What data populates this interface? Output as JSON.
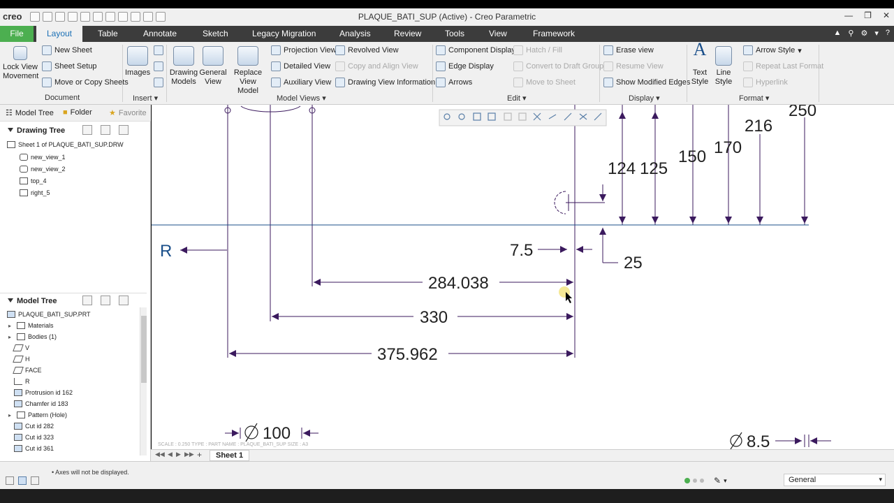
{
  "app": {
    "logo": "creo",
    "title": "PLAQUE_BATI_SUP (Active) - Creo Parametric"
  },
  "tabs": [
    "File",
    "Layout",
    "Table",
    "Annotate",
    "Sketch",
    "Legacy Migration",
    "Analysis",
    "Review",
    "Tools",
    "View",
    "Framework"
  ],
  "ribbon": {
    "document": {
      "group": "Document",
      "lock_view": "Lock View Movement",
      "new_sheet": "New Sheet",
      "sheet_setup": "Sheet Setup",
      "move_copy": "Move or Copy Sheets"
    },
    "insert": {
      "group": "Insert",
      "images": "Images"
    },
    "model_views": {
      "group": "Model Views",
      "drawing_models": "Drawing Models",
      "general_view": "General View",
      "replace_view_model": "Replace View Model",
      "projection_view": "Projection View",
      "detailed_view": "Detailed View",
      "auxiliary_view": "Auxiliary View",
      "revolved_view": "Revolved View",
      "copy_align_view": "Copy and Align View",
      "drawing_view_info": "Drawing View Information"
    },
    "edit": {
      "group": "Edit",
      "component_display": "Component Display",
      "edge_display": "Edge Display",
      "arrows": "Arrows",
      "hatch_fill": "Hatch / Fill",
      "convert_draft": "Convert to Draft Group",
      "move_to_sheet": "Move to Sheet"
    },
    "display": {
      "group": "Display",
      "erase_view": "Erase view",
      "resume_view": "Resume View",
      "show_modified_edges": "Show Modified Edges"
    },
    "format": {
      "group": "Format",
      "text_style": "Text Style",
      "line_style": "Line Style",
      "arrow_style": "Arrow Style",
      "repeat_last_format": "Repeat Last Format",
      "hyperlink": "Hyperlink"
    }
  },
  "panel": {
    "tabs": {
      "model_tree": "Model Tree",
      "folder": "Folder",
      "favorites": "Favorite"
    },
    "drawing_tree": {
      "title": "Drawing Tree",
      "sheet": "Sheet 1 of PLAQUE_BATI_SUP.DRW",
      "items": [
        "new_view_1",
        "new_view_2",
        "top_4",
        "right_5"
      ]
    },
    "model_tree": {
      "title": "Model Tree",
      "root": "PLAQUE_BATI_SUP.PRT",
      "items": [
        "Materials",
        "Bodies (1)",
        "V",
        "H",
        "FACE",
        "R",
        "Protrusion id 162",
        "Chamfer id 183",
        "Pattern (Hole)",
        "Cut id 282",
        "Cut id 323",
        "Cut id 361"
      ]
    }
  },
  "drawing": {
    "dims": {
      "d250": "250",
      "d216": "216",
      "d170": "170",
      "d150": "150",
      "d124": "124",
      "d125": "125",
      "d7_5": "7.5",
      "d25": "25",
      "d284": "284.038",
      "d330": "330",
      "d375": "375.962",
      "d100": "100",
      "d8_5": "8.5"
    },
    "datum_label": "R",
    "scale_note": "SCALE : 0.250    TYPE : PART    NAME : PLAQUE_BATI_SUP    SIZE : A3",
    "line_color": "#3b1a5e",
    "datum_color": "#1a4f8a"
  },
  "sheetbar": {
    "sheet": "Sheet 1"
  },
  "status": {
    "message": "Axes will not be displayed.",
    "filter": "General"
  }
}
